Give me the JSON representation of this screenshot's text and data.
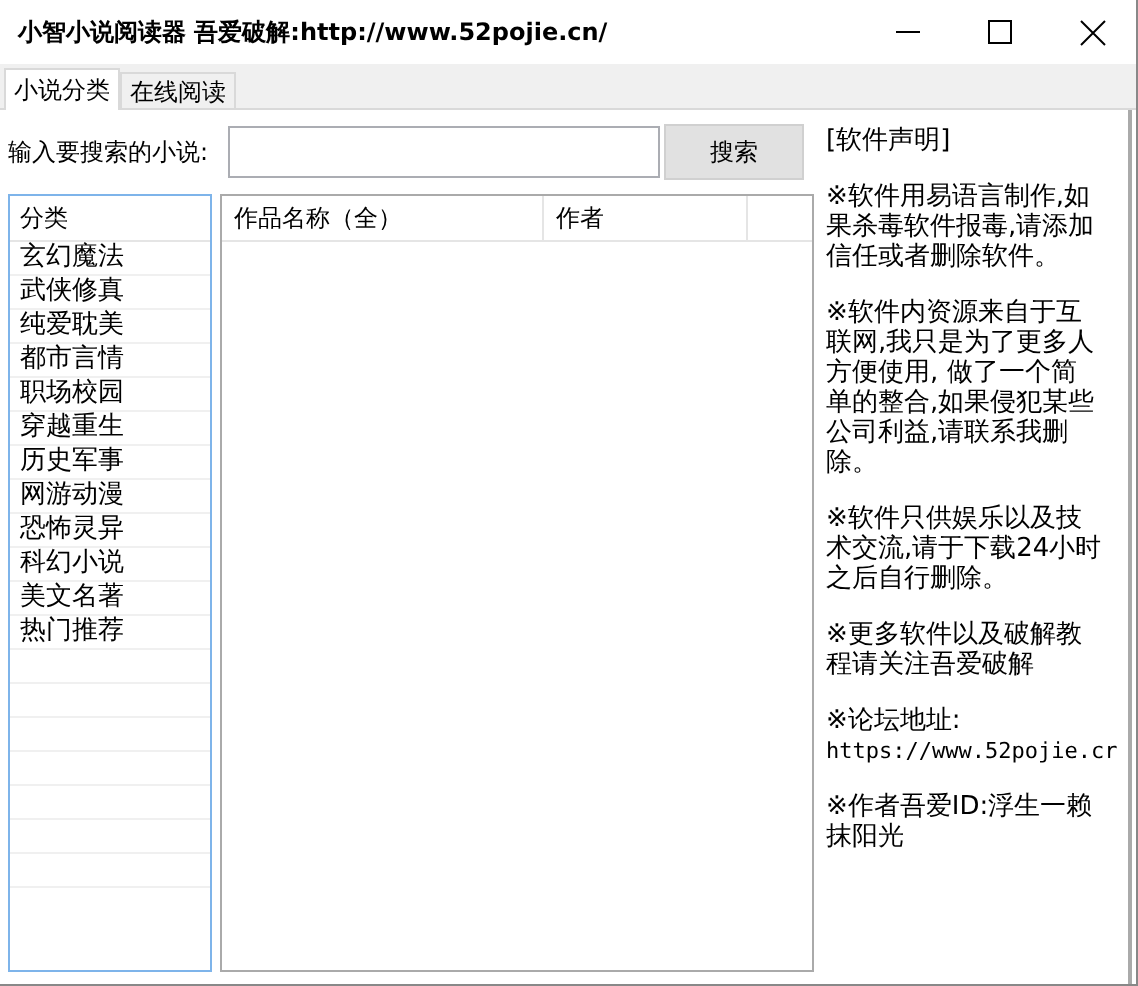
{
  "window": {
    "title": "小智小说阅读器  吾爱破解:http://www.52pojie.cn/"
  },
  "tabs": [
    {
      "label": "小说分类",
      "selected": true
    },
    {
      "label": "在线阅读",
      "selected": false
    }
  ],
  "search": {
    "label": "输入要搜索的小说:",
    "button": "搜索"
  },
  "category_list": {
    "header": "分类",
    "items": [
      "玄幻魔法",
      "武侠修真",
      "纯爱耽美",
      "都市言情",
      "职场校园",
      "穿越重生",
      "历史军事",
      "网游动漫",
      "恐怖灵异",
      "科幻小说",
      "美文名著",
      "热门推荐"
    ]
  },
  "table": {
    "columns": [
      "作品名称（全）",
      "作者"
    ]
  },
  "notice": [
    [
      "[软件声明]"
    ],
    [
      "※软件用易语言制作,如",
      "果杀毒软件报毒,请添加",
      "信任或者删除软件。"
    ],
    [
      "※软件内资源来自于互",
      "联网,我只是为了更多人",
      "方便使用, 做了一个简",
      "单的整合,如果侵犯某些",
      "公司利益,请联系我删",
      "除。"
    ],
    [
      "※软件只供娱乐以及技",
      "术交流,请于下载24小时",
      "之后自行删除。"
    ],
    [
      "※更多软件以及破解教",
      "程请关注吾爱破解"
    ],
    [
      "※论坛地址:",
      "https://www.52pojie.cr"
    ],
    [
      "※作者吾爱ID:浮生一赖",
      "抹阳光"
    ]
  ]
}
